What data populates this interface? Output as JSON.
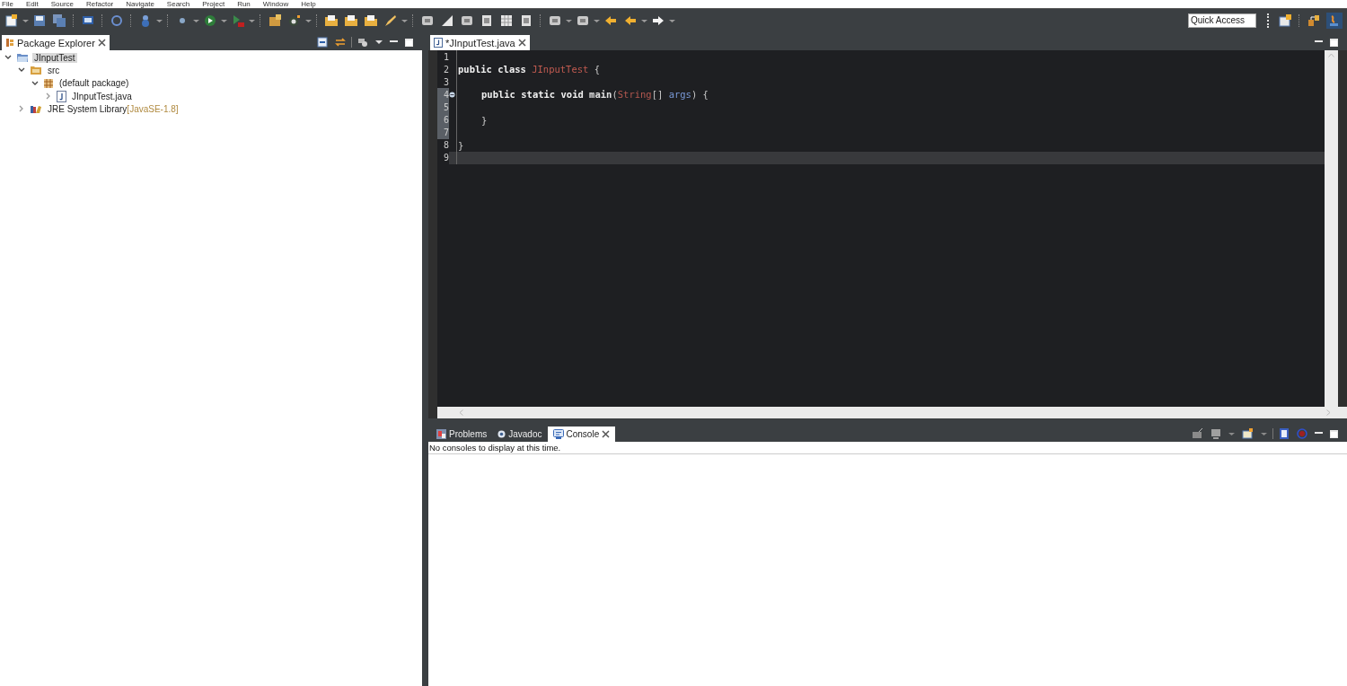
{
  "menu": [
    "File",
    "Edit",
    "Source",
    "Refactor",
    "Navigate",
    "Search",
    "Project",
    "Run",
    "Window",
    "Help"
  ],
  "quick_access": {
    "placeholder": "Quick Access"
  },
  "package_explorer": {
    "tab": {
      "label": "Package Explorer",
      "selected": true
    },
    "tree": [
      {
        "label": "JInputTest",
        "kind": "project",
        "expanded": true,
        "selected": true,
        "children": [
          {
            "label": "src",
            "kind": "source-folder",
            "expanded": true,
            "selected": false,
            "children": [
              {
                "label": "(default package)",
                "kind": "package",
                "expanded": true,
                "selected": false,
                "children": [
                  {
                    "label": "JInputTest.java",
                    "kind": "java-file",
                    "expanded": false,
                    "selected": false
                  }
                ]
              }
            ]
          },
          {
            "label": "JRE System Library",
            "suffix": "[JavaSE-1.8]",
            "kind": "library",
            "expanded": false,
            "selected": false
          }
        ]
      }
    ]
  },
  "editor": {
    "tab": {
      "label": "*JInputTest.java",
      "selected": true
    },
    "lines": [
      {
        "number": "1",
        "marked": false,
        "current": false
      },
      {
        "number": "2",
        "marked": false,
        "current": false,
        "tokens": [
          {
            "kind": "keyword",
            "text": "public class "
          },
          {
            "kind": "classname",
            "text": "JInputTest"
          },
          {
            "kind": "punct",
            "text": " {"
          }
        ]
      },
      {
        "number": "3",
        "marked": false,
        "current": false
      },
      {
        "number": "4",
        "marked": true,
        "current": false,
        "fold": true,
        "indented": true,
        "tokens": [
          {
            "kind": "keyword",
            "text": "public static void "
          },
          {
            "kind": "method",
            "text": "main"
          },
          {
            "kind": "punct",
            "text": "("
          },
          {
            "kind": "type",
            "text": "String"
          },
          {
            "kind": "punct",
            "text": "[] "
          },
          {
            "kind": "param",
            "text": "args"
          },
          {
            "kind": "punct",
            "text": ") {"
          }
        ]
      },
      {
        "number": "5",
        "marked": true,
        "current": false
      },
      {
        "number": "6",
        "marked": true,
        "current": false,
        "indented": true,
        "tokens": [
          {
            "kind": "punct",
            "text": "}"
          }
        ]
      },
      {
        "number": "7",
        "marked": true,
        "current": false
      },
      {
        "number": "8",
        "marked": false,
        "current": false,
        "tokens": [
          {
            "kind": "punct",
            "text": "}"
          }
        ]
      },
      {
        "number": "9",
        "marked": false,
        "current": true
      }
    ]
  },
  "bottom_tabs": [
    {
      "label": "Problems",
      "kind": "problems",
      "selected": false
    },
    {
      "label": "Javadoc",
      "kind": "javadoc",
      "selected": false
    },
    {
      "label": "Console",
      "kind": "console",
      "selected": true
    }
  ],
  "console": {
    "message": "No consoles to display at this time."
  }
}
